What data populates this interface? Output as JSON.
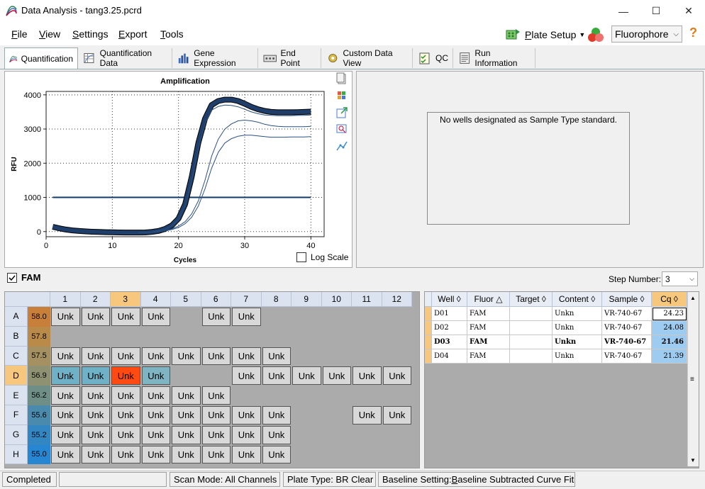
{
  "window": {
    "title": "Data Analysis - tang3.25.pcrd",
    "minimize": "—",
    "maximize": "☐",
    "close": "✕"
  },
  "menu": [
    {
      "label": "File",
      "mnemonic": "F",
      "rest": "ile"
    },
    {
      "label": "View",
      "mnemonic": "V",
      "rest": "iew"
    },
    {
      "label": "Settings",
      "mnemonic": "S",
      "rest": "ettings"
    },
    {
      "label": "Export",
      "mnemonic": "E",
      "rest": "xport"
    },
    {
      "label": "Tools",
      "mnemonic": "T",
      "rest": "ools"
    }
  ],
  "toolbar": {
    "plate_setup": "Plate Setup",
    "plate_setup_mnemonic": "P",
    "plate_setup_rest": "late Setup",
    "fluorophore": "Fluorophore",
    "help": "?"
  },
  "tabs": [
    "Quantification",
    "Quantification Data",
    "Gene Expression",
    "End Point",
    "Custom Data View",
    "QC",
    "Run Information"
  ],
  "chart_data": {
    "type": "line",
    "title": "Amplification",
    "xlabel": "Cycles",
    "ylabel": "RFU",
    "xlim": [
      0,
      42
    ],
    "ylim": [
      -150,
      4100
    ],
    "xticks": [
      0,
      10,
      20,
      30,
      40
    ],
    "yticks": [
      0,
      1000,
      2000,
      3000,
      4000
    ],
    "threshold": 1000,
    "grid": true,
    "series": [
      {
        "color": "#1f3f6a",
        "width": 6,
        "x": [
          1,
          2,
          3,
          4,
          5,
          6,
          7,
          8,
          9,
          10,
          11,
          12,
          13,
          14,
          15,
          16,
          17,
          18,
          19,
          20,
          21,
          22,
          23,
          24,
          25,
          26,
          27,
          28,
          29,
          30,
          31,
          32,
          33,
          34,
          35,
          36,
          37,
          38,
          39,
          40
        ],
        "y": [
          140,
          95,
          60,
          35,
          18,
          5,
          -5,
          -12,
          -18,
          -22,
          -25,
          -27,
          -28,
          -28,
          -25,
          -10,
          20,
          80,
          180,
          380,
          800,
          1600,
          2600,
          3300,
          3700,
          3820,
          3860,
          3860,
          3820,
          3740,
          3650,
          3580,
          3530,
          3500,
          3490,
          3490,
          3490,
          3495,
          3500,
          3510
        ]
      },
      {
        "color": "#2a5080",
        "width": 1,
        "x": [
          14,
          16,
          18,
          19,
          20,
          21,
          22,
          23,
          24,
          25,
          26,
          27,
          28,
          29,
          30,
          31,
          32,
          33,
          34,
          35,
          36,
          37,
          38,
          39,
          40
        ],
        "y": [
          -28,
          -10,
          70,
          170,
          360,
          760,
          1520,
          2450,
          3150,
          3550,
          3660,
          3700,
          3690,
          3650,
          3580,
          3500,
          3450,
          3410,
          3400,
          3390,
          3390,
          3390,
          3400,
          3400,
          3410
        ]
      },
      {
        "color": "#2a5080",
        "width": 1,
        "x": [
          14,
          16,
          18,
          19,
          20,
          21,
          22,
          23,
          24,
          25,
          26,
          27,
          28,
          29,
          30,
          31,
          32,
          33,
          34,
          35,
          36,
          37,
          38,
          39,
          40
        ],
        "y": [
          -28,
          -15,
          30,
          80,
          160,
          290,
          520,
          900,
          1500,
          2200,
          2700,
          3000,
          3150,
          3240,
          3260,
          3240,
          3200,
          3140,
          3100,
          3080,
          3070,
          3070,
          3070,
          3070,
          3080
        ]
      },
      {
        "color": "#2a5080",
        "width": 1,
        "x": [
          14,
          16,
          18,
          19,
          20,
          21,
          22,
          23,
          24,
          25,
          26,
          27,
          28,
          29,
          30,
          31,
          32,
          33,
          34,
          35,
          36,
          37,
          38,
          39,
          40
        ],
        "y": [
          -28,
          -15,
          20,
          60,
          120,
          230,
          420,
          750,
          1250,
          1850,
          2320,
          2590,
          2720,
          2790,
          2820,
          2820,
          2800,
          2780,
          2760,
          2760,
          2760,
          2770,
          2770,
          2770,
          2780
        ]
      }
    ]
  },
  "log_scale_label": "Log Scale",
  "std_message": "No wells designated as Sample Type standard.",
  "fam": {
    "label": "FAM"
  },
  "step": {
    "label": "Step Number:",
    "value": "3"
  },
  "plate": {
    "columns": [
      "1",
      "2",
      "3",
      "4",
      "5",
      "6",
      "7",
      "8",
      "9",
      "10",
      "11",
      "12"
    ],
    "rows": [
      {
        "label": "A",
        "temp": "58.0",
        "tcolor": "#c87f3a",
        "wells": [
          "Unk",
          "Unk",
          "Unk",
          "Unk",
          "",
          "Unk",
          "Unk",
          "",
          "",
          "",
          "",
          ""
        ]
      },
      {
        "label": "B",
        "temp": "57.8",
        "tcolor": "#b98a48",
        "wells": [
          "",
          "",
          "",
          "",
          "",
          "",
          "",
          "",
          "",
          "",
          "",
          ""
        ]
      },
      {
        "label": "C",
        "temp": "57.5",
        "tcolor": "#a49060",
        "wells": [
          "Unk",
          "Unk",
          "Unk",
          "Unk",
          "Unk",
          "Unk",
          "Unk",
          "Unk",
          "",
          "",
          "",
          ""
        ]
      },
      {
        "label": "D",
        "temp": "56.9",
        "tcolor": "#8e9272",
        "wells": [
          "Unk",
          "Unk",
          "Unk",
          "Unk",
          "",
          "",
          "Unk",
          "Unk",
          "Unk",
          "Unk",
          "Unk",
          "Unk"
        ]
      },
      {
        "label": "E",
        "temp": "56.2",
        "tcolor": "#6f8f86",
        "wells": [
          "Unk",
          "Unk",
          "Unk",
          "Unk",
          "Unk",
          "Unk",
          "",
          "",
          "",
          "",
          "",
          ""
        ]
      },
      {
        "label": "F",
        "temp": "55.6",
        "tcolor": "#4a8aac",
        "wells": [
          "Unk",
          "Unk",
          "Unk",
          "Unk",
          "Unk",
          "Unk",
          "Unk",
          "Unk",
          "",
          "",
          "Unk",
          "Unk"
        ]
      },
      {
        "label": "G",
        "temp": "55.2",
        "tcolor": "#3287c2",
        "wells": [
          "Unk",
          "Unk",
          "Unk",
          "Unk",
          "Unk",
          "Unk",
          "Unk",
          "Unk",
          "",
          "",
          "",
          ""
        ]
      },
      {
        "label": "H",
        "temp": "55.0",
        "tcolor": "#2686d2",
        "wells": [
          "Unk",
          "Unk",
          "Unk",
          "Unk",
          "Unk",
          "Unk",
          "Unk",
          "Unk",
          "",
          "",
          "",
          ""
        ]
      }
    ],
    "highlight": {
      "D1": "#6fb1c6",
      "D2": "#6fb1c6",
      "D3": "#ff4a12",
      "D4": "#7fb5c2"
    }
  },
  "well_table": {
    "headers": [
      "Well",
      "Fluor",
      "Target",
      "Content",
      "Sample",
      "Cq"
    ],
    "rows": [
      {
        "well": "D01",
        "fluor": "FAM",
        "target": "",
        "content": "Unkn",
        "sample": "VR-740-67",
        "cq": "24.23",
        "bold": false
      },
      {
        "well": "D02",
        "fluor": "FAM",
        "target": "",
        "content": "Unkn",
        "sample": "VR-740-67",
        "cq": "24.08",
        "bold": false
      },
      {
        "well": "D03",
        "fluor": "FAM",
        "target": "",
        "content": "Unkn",
        "sample": "VR-740-67",
        "cq": "21.46",
        "bold": true
      },
      {
        "well": "D04",
        "fluor": "FAM",
        "target": "",
        "content": "Unkn",
        "sample": "VR-740-67",
        "cq": "21.39",
        "bold": false
      }
    ]
  },
  "status": {
    "completed": "Completed",
    "scan_mode": "Scan Mode: All Channels",
    "plate_type": "Plate Type: BR Clear",
    "baseline_prefix": "Baseline Setting: ",
    "baseline_mn": "B",
    "baseline_rest": "aseline Subtracted Curve Fit"
  }
}
